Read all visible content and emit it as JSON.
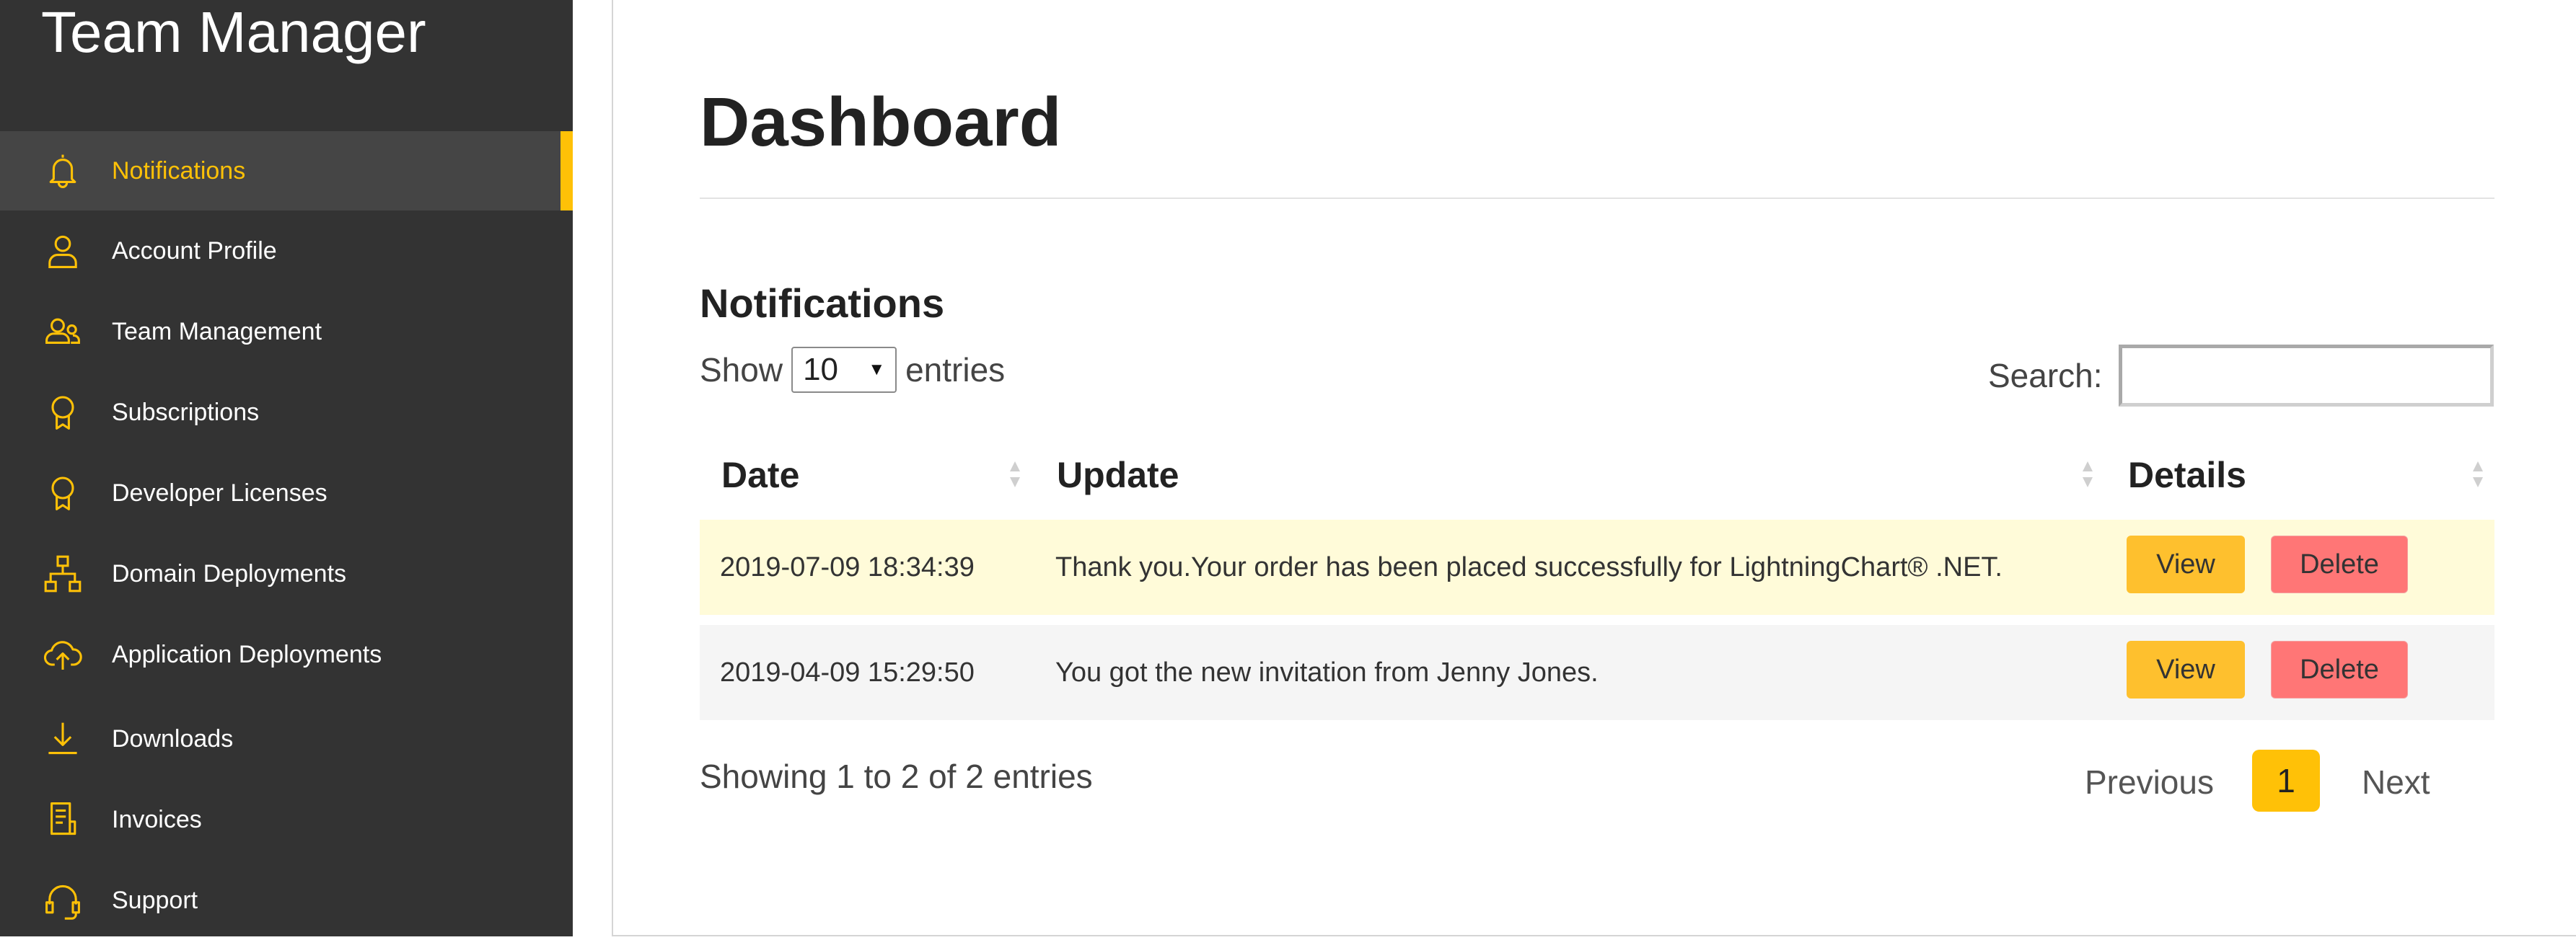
{
  "app": {
    "title": "Team Manager"
  },
  "colors": {
    "accent": "#ffc107",
    "sidebar_bg": "#333333",
    "view_button": "#fec02e",
    "delete_button": "#ff7676"
  },
  "sidebar": {
    "items": [
      {
        "label": "Notifications",
        "icon": "bell-icon",
        "active": true
      },
      {
        "label": "Account Profile",
        "icon": "user-icon"
      },
      {
        "label": "Team Management",
        "icon": "users-icon"
      },
      {
        "label": "Subscriptions",
        "icon": "award-icon"
      },
      {
        "label": "Developer Licenses",
        "icon": "award-icon"
      },
      {
        "label": "Domain Deployments",
        "icon": "sitemap-icon"
      },
      {
        "label": "Application Deployments",
        "icon": "cloud-upload-icon"
      },
      {
        "label": "Downloads",
        "icon": "download-icon"
      },
      {
        "label": "Invoices",
        "icon": "invoice-icon"
      },
      {
        "label": "Support",
        "icon": "headset-icon"
      }
    ]
  },
  "main": {
    "title": "Dashboard",
    "section_title": "Notifications",
    "show_label": "Show",
    "entries_value": "10",
    "entries_label": "entries",
    "search_label": "Search:",
    "search_value": "",
    "table": {
      "columns": [
        "Date",
        "Update",
        "Details"
      ],
      "rows": [
        {
          "date": "2019-07-09 18:34:39",
          "update": "Thank you.Your order has been placed successfully for LightningChart® .NET.",
          "view": "View",
          "delete": "Delete"
        },
        {
          "date": "2019-04-09 15:29:50",
          "update": "You got the new invitation from Jenny Jones.",
          "view": "View",
          "delete": "Delete"
        }
      ]
    },
    "info": "Showing 1 to 2 of 2 entries",
    "pagination": {
      "previous": "Previous",
      "current": "1",
      "next": "Next"
    }
  }
}
